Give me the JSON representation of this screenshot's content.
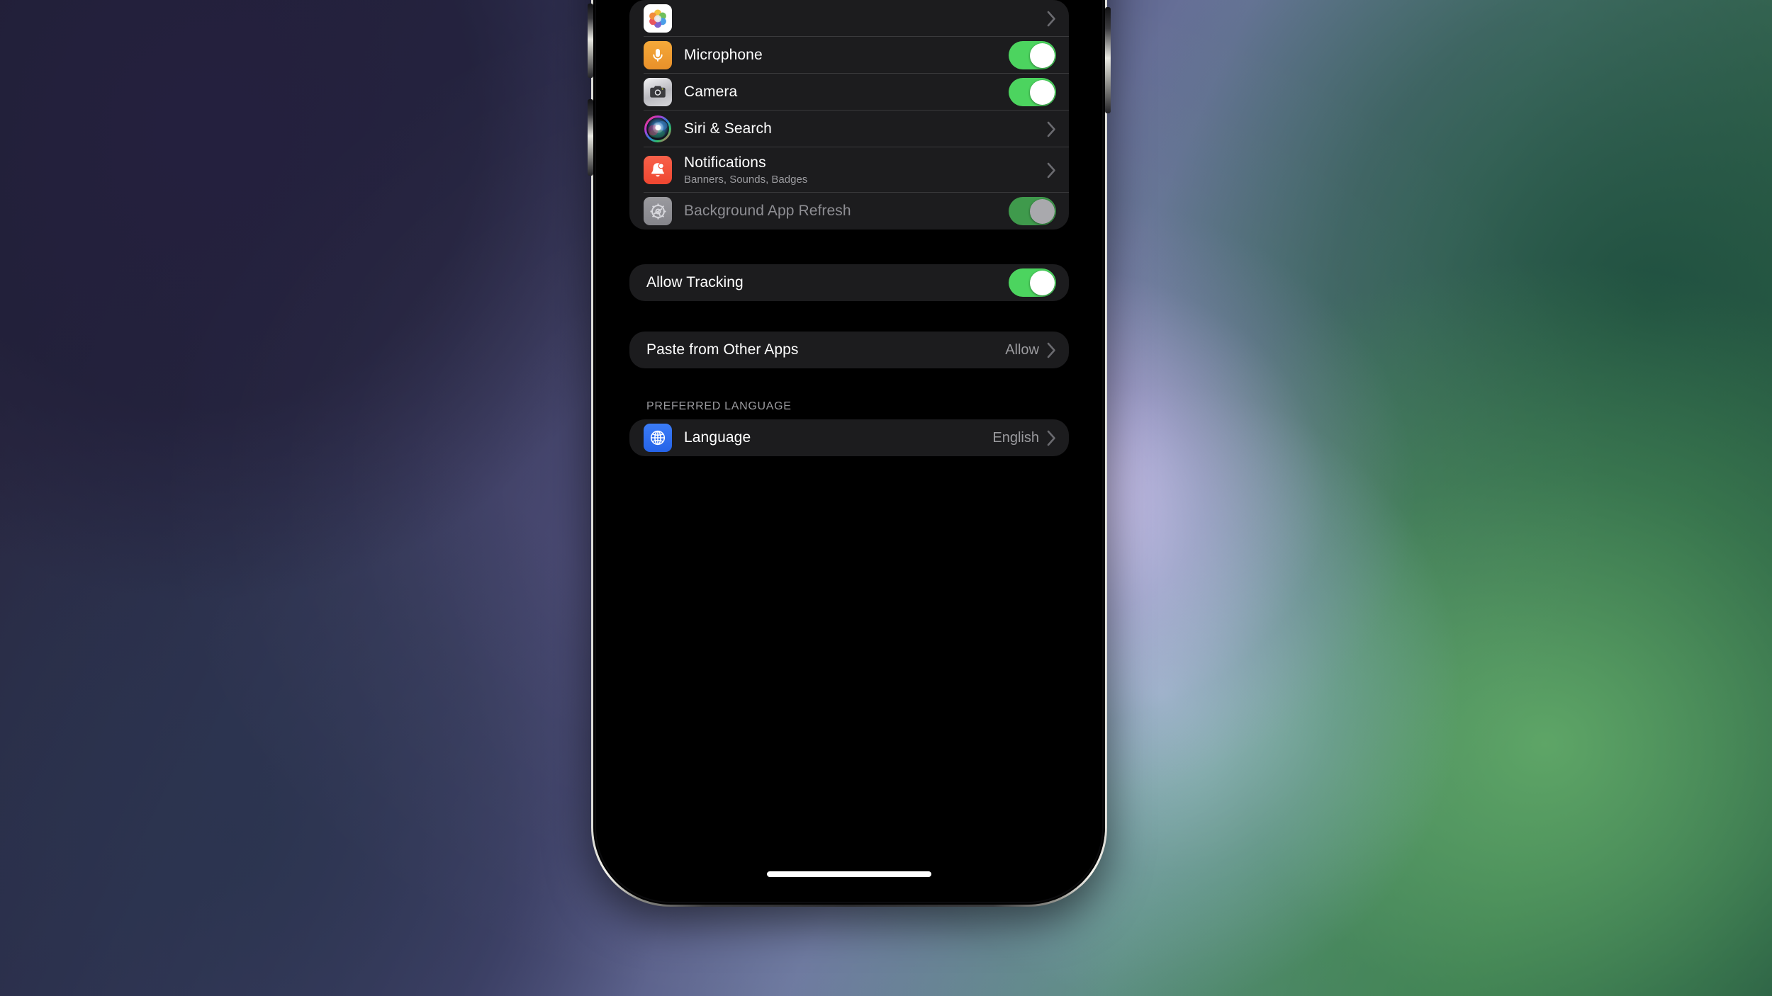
{
  "app": {
    "platform": "iOS",
    "screen_name": "App Settings"
  },
  "colors": {
    "toggle_on": "#4CD45F",
    "toggle_on_disabled": "#3F9A4C",
    "card_bg": "#1C1C1E",
    "screen_bg": "#000000",
    "separator": "#3A3A3C",
    "primary_text": "#FFFFFF",
    "secondary_text": "#9B9B9F",
    "disabled_text": "#8E8E93",
    "icon_microphone_bg": "#F09A2B",
    "icon_camera_bg": "#C7C7CC",
    "icon_notifications_bg": "#F3553C",
    "icon_background_refresh_bg": "#8E8E93",
    "icon_language_bg": "#2D6FF5"
  },
  "sections": [
    {
      "name": "permissions",
      "header": "",
      "rows": [
        {
          "name": "photos",
          "icon": "photos-icon",
          "title": "",
          "subtitle": "",
          "accessory": "partial",
          "partially_visible": true
        },
        {
          "name": "microphone",
          "icon": "microphone-icon",
          "title": "Microphone",
          "subtitle": "",
          "accessory": "toggle",
          "toggle_on": true,
          "disabled": false
        },
        {
          "name": "camera",
          "icon": "camera-icon",
          "title": "Camera",
          "subtitle": "",
          "accessory": "toggle",
          "toggle_on": true,
          "disabled": false
        },
        {
          "name": "siri-and-search",
          "icon": "siri-icon",
          "title": "Siri & Search",
          "subtitle": "",
          "accessory": "chevron"
        },
        {
          "name": "notifications",
          "icon": "notifications-bell-icon",
          "title": "Notifications",
          "subtitle": "Banners, Sounds, Badges",
          "accessory": "chevron"
        },
        {
          "name": "background-app-refresh",
          "icon": "gear-icon",
          "title": "Background App Refresh",
          "subtitle": "",
          "accessory": "toggle",
          "toggle_on": true,
          "disabled": true
        }
      ]
    },
    {
      "name": "tracking",
      "header": "",
      "rows": [
        {
          "name": "allow-tracking",
          "icon": "",
          "title": "Allow Tracking",
          "subtitle": "",
          "accessory": "toggle",
          "toggle_on": true,
          "disabled": false
        }
      ]
    },
    {
      "name": "paste",
      "header": "",
      "rows": [
        {
          "name": "paste-from-other-apps",
          "icon": "",
          "title": "Paste from Other Apps",
          "subtitle": "",
          "value": "Allow",
          "accessory": "chevron"
        }
      ]
    },
    {
      "name": "preferred-language",
      "header": "PREFERRED LANGUAGE",
      "rows": [
        {
          "name": "language",
          "icon": "globe-icon",
          "title": "Language",
          "subtitle": "",
          "value": "English",
          "accessory": "chevron"
        }
      ]
    }
  ]
}
